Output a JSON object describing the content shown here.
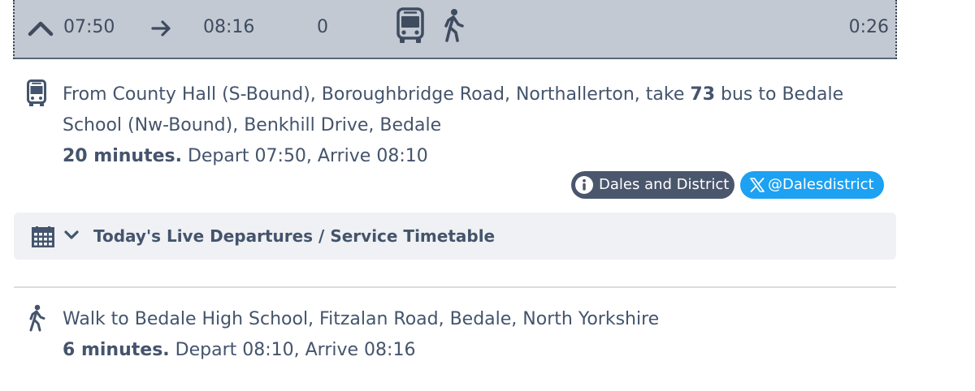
{
  "summary": {
    "depart": "07:50",
    "arrive": "08:16",
    "changes": "0",
    "duration": "0:26",
    "modes": [
      "bus-icon",
      "walk-icon"
    ],
    "expand_icon": "chevron-up-icon",
    "arrow_icon": "arrow-right-icon",
    "bg_color": "#c2c9d3"
  },
  "bus_leg": {
    "icon": "bus-icon",
    "text_before": "From County Hall (S-Bound), Boroughbridge Road, Northallerton, take ",
    "route": "73",
    "text_after": " bus to Bedale School (Nw-Bound), Benkhill Drive, Bedale",
    "duration": "20 minutes.",
    "times": " Depart 07:50, Arrive 08:10",
    "operator_label": "Dales and District",
    "operator_icon": "info-icon",
    "operator_color": "#4a566c",
    "twitter_label": "@Dalesdistrict",
    "twitter_icon": "x-logo-icon",
    "twitter_color": "#1da1f2"
  },
  "timetable": {
    "label": "Today's Live Departures / Service Timetable",
    "icon": "calendar-icon",
    "toggle_icon": "chevron-down-icon"
  },
  "walk_leg": {
    "icon": "walk-icon",
    "text": "Walk to Bedale High School, Fitzalan Road, Bedale, North Yorkshire",
    "duration": "6 minutes.",
    "times": " Depart 08:10, Arrive 08:16"
  }
}
